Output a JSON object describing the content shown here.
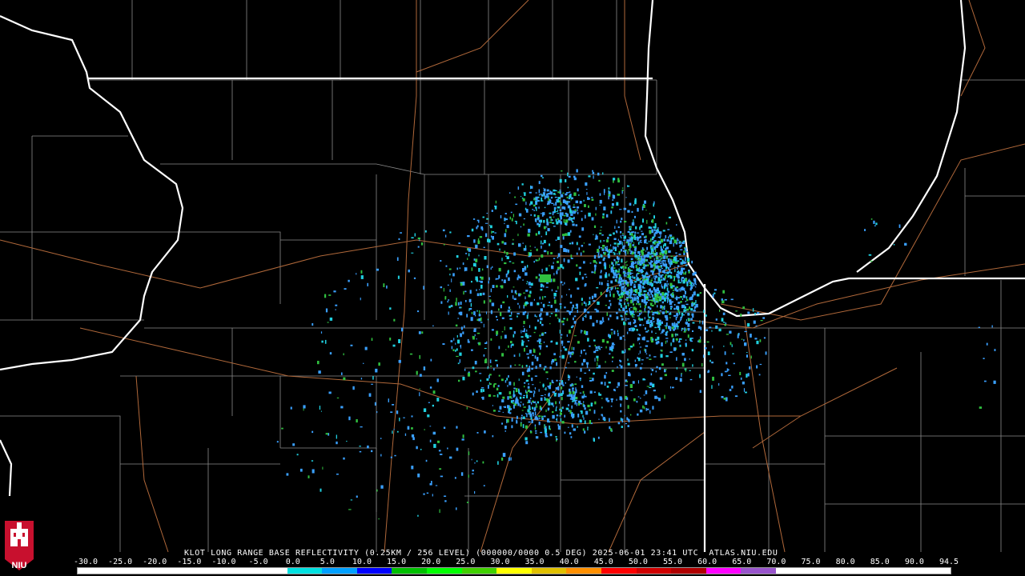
{
  "caption": "KLOT LONG RANGE BASE REFLECTIVITY (0.25KM / 256 LEVEL) (000000/0000 0.5 DEG) 2025-06-01 23:41 UTC  ATLAS.NIU.EDU",
  "scale_labels": [
    "-30.0",
    "-25.0",
    "-20.0",
    "-15.0",
    "-10.0",
    "-5.0",
    "0.0",
    "5.0",
    "10.0",
    "15.0",
    "20.0",
    "25.0",
    "30.0",
    "35.0",
    "40.0",
    "45.0",
    "50.0",
    "55.0",
    "60.0",
    "65.0",
    "70.0",
    "75.0",
    "80.0",
    "85.0",
    "90.0",
    "94.5"
  ],
  "scale_colors": [
    "#ffffff",
    "#ffffff",
    "#ffffff",
    "#ffffff",
    "#ffffff",
    "#ffffff",
    "#00e0e0",
    "#00a0ff",
    "#0000ff",
    "#00c000",
    "#00ff00",
    "#40d000",
    "#ffff00",
    "#e0c000",
    "#ff9000",
    "#ff0000",
    "#d00000",
    "#b00000",
    "#ff00ff",
    "#9955cc",
    "#ffffff",
    "#ffffff",
    "#ffffff",
    "#ffffff",
    "#ffffff"
  ],
  "logo": {
    "text": "NIU",
    "icon": "university-tower-icon",
    "color": "#c8102e"
  },
  "colors": {
    "background": "#000000",
    "state_lines": "#ffffff",
    "county_lines": "#8a8a8a",
    "roads": "#b0683a",
    "echo_light": "#3aa0ff",
    "echo_cyan": "#20d0e0",
    "echo_green": "#30c040"
  }
}
